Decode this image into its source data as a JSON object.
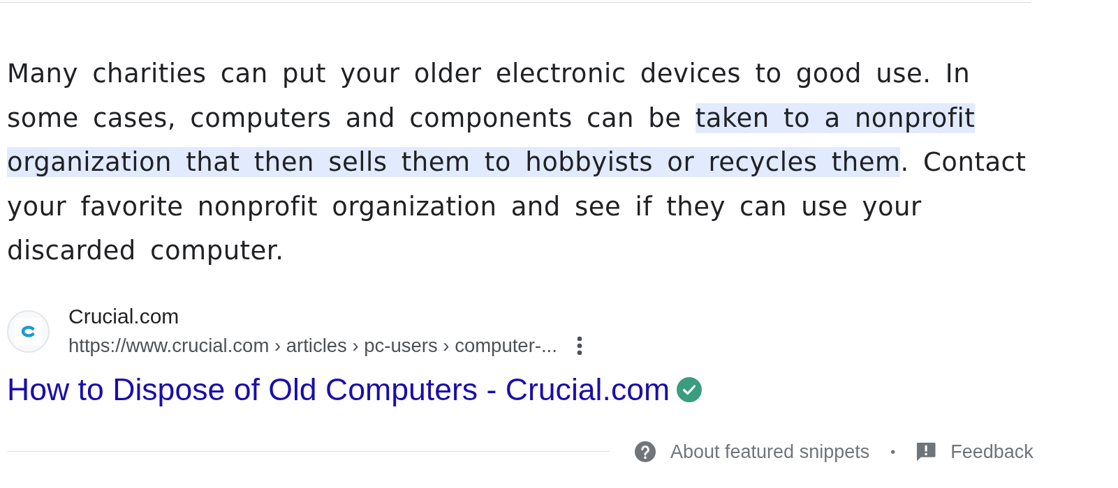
{
  "snippet": {
    "segments": [
      {
        "text": "Many charities can put your older electronic devices to good use. In some cases, computers and components can be ",
        "highlighted": false
      },
      {
        "text": "taken to a nonprofit organization that then sells them to hobbyists or recycles them",
        "highlighted": true
      },
      {
        "text": ". Contact your favorite nonprofit organization and see if they can use your discarded computer.",
        "highlighted": false
      }
    ]
  },
  "source": {
    "site_name": "Crucial.com",
    "url": "https://www.crucial.com › articles › pc-users › computer-..."
  },
  "result_title": {
    "text": "How to Dispose of Old Computers - Crucial.com",
    "verified": true
  },
  "footer": {
    "about": "About featured snippets",
    "separator": "•",
    "feedback": "Feedback"
  }
}
